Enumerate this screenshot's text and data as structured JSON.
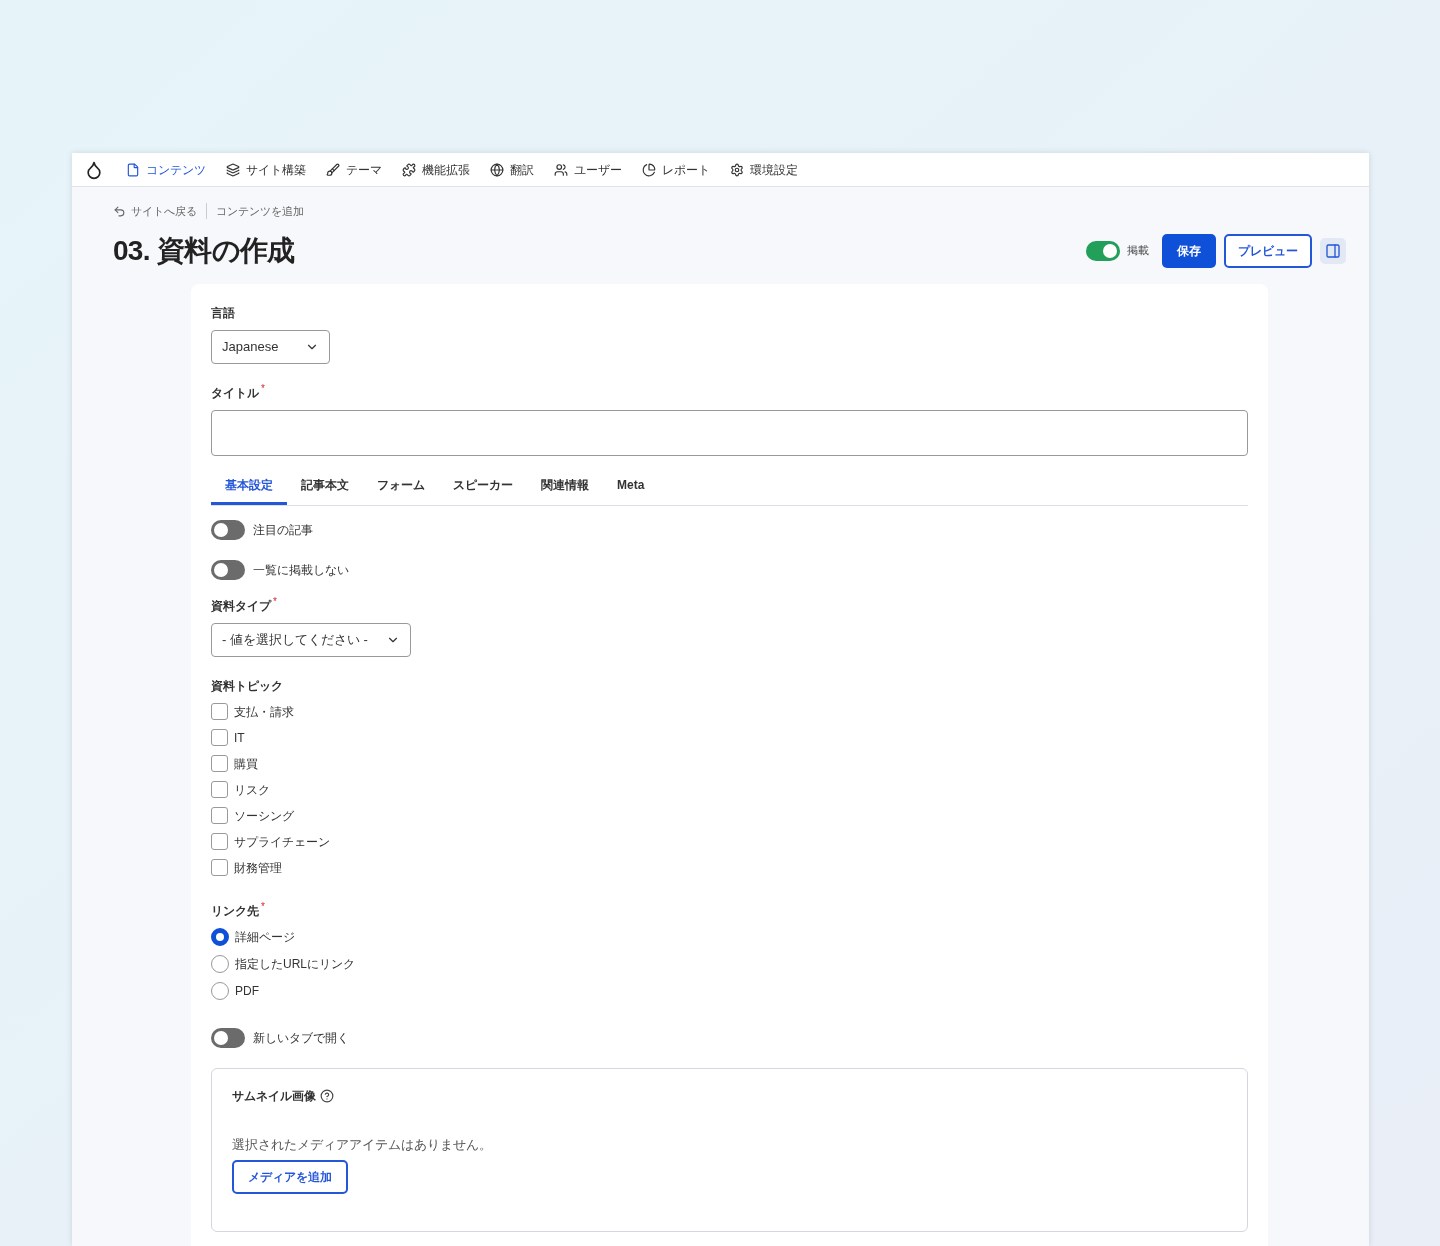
{
  "nav": {
    "items": [
      {
        "label": "コンテンツ",
        "selected": true
      },
      {
        "label": "サイト構築",
        "selected": false
      },
      {
        "label": "テーマ",
        "selected": false
      },
      {
        "label": "機能拡張",
        "selected": false
      },
      {
        "label": "翻訳",
        "selected": false
      },
      {
        "label": "ユーザー",
        "selected": false
      },
      {
        "label": "レポート",
        "selected": false
      },
      {
        "label": "環境設定",
        "selected": false
      }
    ]
  },
  "breadcrumb": {
    "back": "サイトへ戻る",
    "current": "コンテンツを追加"
  },
  "page_title": "03. 資料の作成",
  "actions": {
    "publish": {
      "label": "掲載",
      "on": true
    },
    "save": "保存",
    "preview": "プレビュー"
  },
  "form": {
    "language": {
      "label": "言語",
      "value": "Japanese"
    },
    "title_field": {
      "label": "タイトル",
      "required_mark": "*"
    },
    "tabs": [
      {
        "label": "基本設定",
        "selected": true
      },
      {
        "label": "記事本文",
        "selected": false
      },
      {
        "label": "フォーム",
        "selected": false
      },
      {
        "label": "スピーカー",
        "selected": false
      },
      {
        "label": "関連情報",
        "selected": false
      },
      {
        "label": "Meta",
        "selected": false
      }
    ],
    "toggles": [
      {
        "label": "注目の記事",
        "on": false
      },
      {
        "label": "一覧に掲載しない",
        "on": false
      }
    ],
    "material_type": {
      "label": "資料タイプ",
      "required_mark": "*",
      "value": "- 値を選択してください -"
    },
    "topics": {
      "label": "資料トピック",
      "options": [
        {
          "label": "支払・請求",
          "checked": false
        },
        {
          "label": "IT",
          "checked": false
        },
        {
          "label": "購買",
          "checked": false
        },
        {
          "label": "リスク",
          "checked": false
        },
        {
          "label": "ソーシング",
          "checked": false
        },
        {
          "label": "サプライチェーン",
          "checked": false
        },
        {
          "label": "財務管理",
          "checked": false
        }
      ]
    },
    "link_target": {
      "label": "リンク先",
      "required_mark": "*",
      "options": [
        {
          "label": "詳細ページ",
          "selected": true
        },
        {
          "label": "指定したURLにリンク",
          "selected": false
        },
        {
          "label": "PDF",
          "selected": false
        }
      ]
    },
    "new_tab": {
      "label": "新しいタブで開く",
      "on": false
    },
    "thumbnail": {
      "label": "サムネイル画像",
      "empty_text": "選択されたメディアアイテムはありません。",
      "button": "メディアを追加"
    }
  }
}
